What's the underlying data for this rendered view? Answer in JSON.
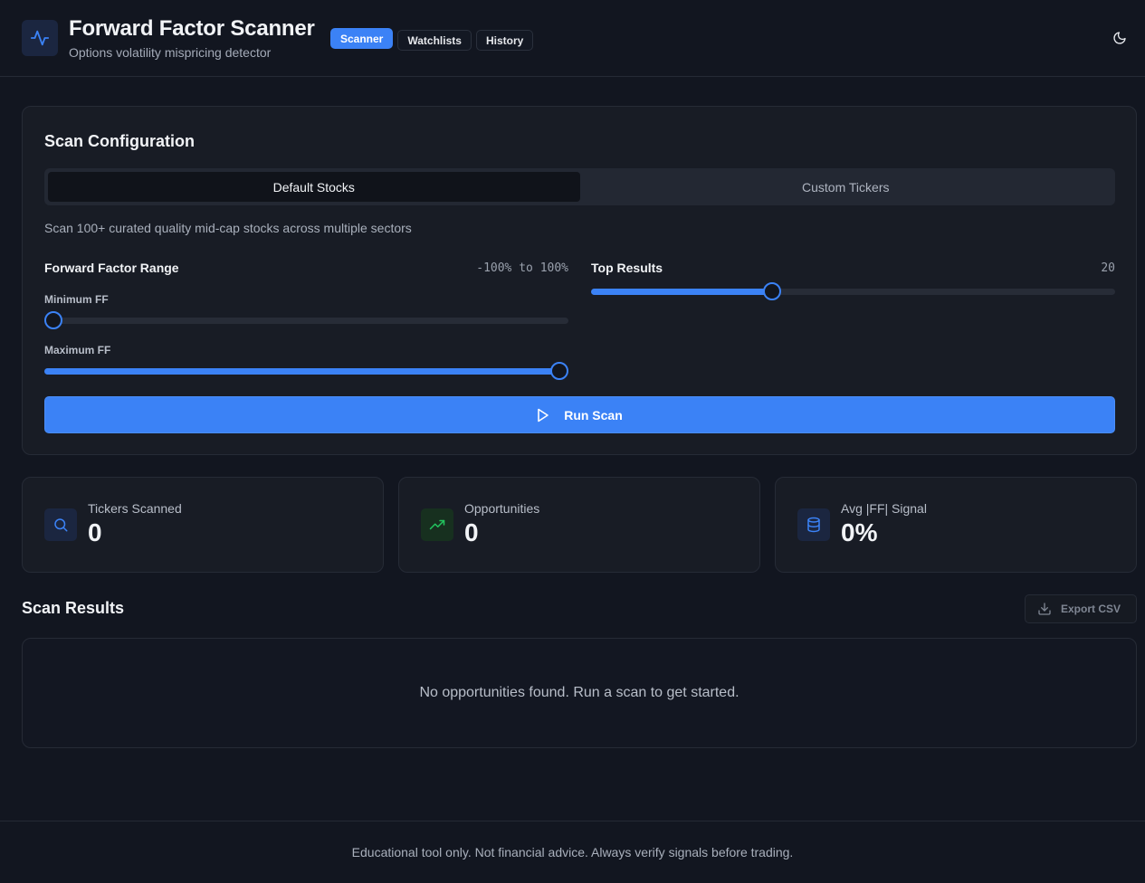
{
  "header": {
    "title": "Forward Factor Scanner",
    "subtitle": "Options volatility mispricing detector",
    "logo_icon": "activity-pulse-icon",
    "nav": [
      {
        "label": "Scanner",
        "active": true
      },
      {
        "label": "Watchlists",
        "active": false
      },
      {
        "label": "History",
        "active": false
      }
    ],
    "theme_icon": "moon-icon"
  },
  "config": {
    "title": "Scan Configuration",
    "tabs": [
      {
        "label": "Default Stocks",
        "active": true
      },
      {
        "label": "Custom Tickers",
        "active": false
      }
    ],
    "description": "Scan 100+ curated quality mid-cap stocks across multiple sectors",
    "ff_range": {
      "label": "Forward Factor Range",
      "value_text": "-100% to 100%",
      "min_label": "Minimum FF",
      "min_value": -100,
      "max_label": "Maximum FF",
      "max_value": 100,
      "slider_min": -100,
      "slider_max": 100
    },
    "top_results": {
      "label": "Top Results",
      "value": 20,
      "value_text": "20",
      "slider_fraction": 0.34
    },
    "run_button": "Run Scan"
  },
  "stats": [
    {
      "label": "Tickers Scanned",
      "value": "0",
      "icon": "search-icon",
      "color": "#3b82f6"
    },
    {
      "label": "Opportunities",
      "value": "0",
      "icon": "trending-up-icon",
      "color": "#22c55e"
    },
    {
      "label": "Avg |FF| Signal",
      "value": "0%",
      "icon": "database-icon",
      "color": "#3b82f6"
    }
  ],
  "results": {
    "title": "Scan Results",
    "export_label": "Export CSV",
    "empty_message": "No opportunities found. Run a scan to get started."
  },
  "footer": {
    "text": "Educational tool only. Not financial advice. Always verify signals before trading."
  },
  "colors": {
    "accent": "#3b82f6",
    "background": "#121620",
    "card": "#181c25"
  }
}
